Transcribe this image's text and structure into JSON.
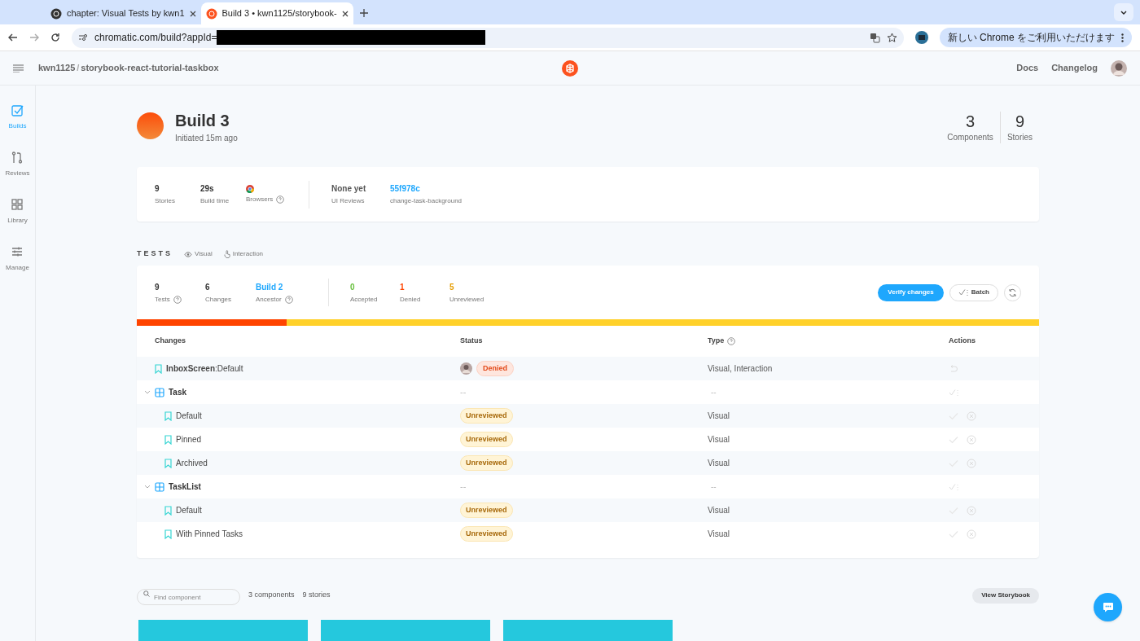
{
  "browser": {
    "tabs": [
      {
        "title": "chapter: Visual Tests by kwn1",
        "selected": false
      },
      {
        "title": "Build 3 • kwn1125/storybook-",
        "selected": true
      }
    ],
    "url": "chromatic.com/build?appId=",
    "update_button": "新しい Chrome をご利用いただけます"
  },
  "header": {
    "owner": "kwn1125",
    "separator": "/",
    "repo": "storybook-react-tutorial-taskbox",
    "links": [
      "Docs",
      "Changelog"
    ]
  },
  "sidebar": {
    "items": [
      {
        "label": "Builds",
        "selected": true
      },
      {
        "label": "Reviews",
        "selected": false
      },
      {
        "label": "Library",
        "selected": false
      },
      {
        "label": "Manage",
        "selected": false
      }
    ]
  },
  "build": {
    "title": "Build 3",
    "subtitle": "Initiated 15m ago",
    "counts": [
      {
        "value": "3",
        "label": "Components"
      },
      {
        "value": "9",
        "label": "Stories"
      }
    ]
  },
  "summary": {
    "stats": [
      {
        "value": "9",
        "label": "Stories"
      },
      {
        "value": "29s",
        "label": "Build time"
      }
    ],
    "browsers_label": "Browsers",
    "reviews": {
      "value": "None yet",
      "label": "UI Reviews"
    },
    "commit": {
      "value": "55f978c",
      "label": "change-task-background"
    }
  },
  "tests": {
    "heading": "TESTS",
    "filters": [
      "Visual",
      "Interaction"
    ],
    "stats": [
      {
        "value": "9",
        "label": "Tests",
        "help": true,
        "color": "#333333"
      },
      {
        "value": "6",
        "label": "Changes",
        "help": false,
        "color": "#333333"
      },
      {
        "value": "Build 2",
        "label": "Ancestor",
        "help": true,
        "color": "#1ea7fd"
      }
    ],
    "results": [
      {
        "value": "0",
        "label": "Accepted",
        "color": "#66bf3c"
      },
      {
        "value": "1",
        "label": "Denied",
        "color": "#ff4400"
      },
      {
        "value": "5",
        "label": "Unreviewed",
        "color": "#e69d00"
      }
    ],
    "verify_button": "Verify changes",
    "batch_button": "Batch",
    "progress": [
      {
        "color": "#ff4400",
        "level": 0.166
      },
      {
        "color": "#ffd12a",
        "level": 0.834
      }
    ],
    "columns": [
      "Changes",
      "Status",
      "Type",
      "Actions"
    ],
    "rows": [
      {
        "kind": "story",
        "name": "**InboxScreen**:Default",
        "status": {
          "kind": "denied",
          "label": "Denied"
        },
        "type": "Visual, Interaction"
      },
      {
        "kind": "group",
        "name": "Task",
        "expanded": true,
        "status_text": "--",
        "type": "--",
        "children": [
          {
            "kind": "story",
            "name": "Default",
            "status": {
              "kind": "unreviewed",
              "label": "Unreviewed"
            },
            "type": "Visual"
          },
          {
            "kind": "story",
            "name": "Pinned",
            "status": {
              "kind": "unreviewed",
              "label": "Unreviewed"
            },
            "type": "Visual"
          },
          {
            "kind": "story",
            "name": "Archived",
            "status": {
              "kind": "unreviewed",
              "label": "Unreviewed"
            },
            "type": "Visual"
          }
        ]
      },
      {
        "kind": "group",
        "name": "TaskList",
        "expanded": true,
        "status_text": "--",
        "type": "--",
        "children": [
          {
            "kind": "story",
            "name": "Default",
            "status": {
              "kind": "unreviewed",
              "label": "Unreviewed"
            },
            "type": "Visual"
          },
          {
            "kind": "story",
            "name": "With Pinned Tasks",
            "status": {
              "kind": "unreviewed",
              "label": "Unreviewed"
            },
            "type": "Visual"
          }
        ]
      }
    ]
  },
  "library": {
    "search": {
      "placeholder": "Find component"
    },
    "components": "3 components",
    "stories": "9 stories",
    "storybook_button": "View Storybook"
  }
}
